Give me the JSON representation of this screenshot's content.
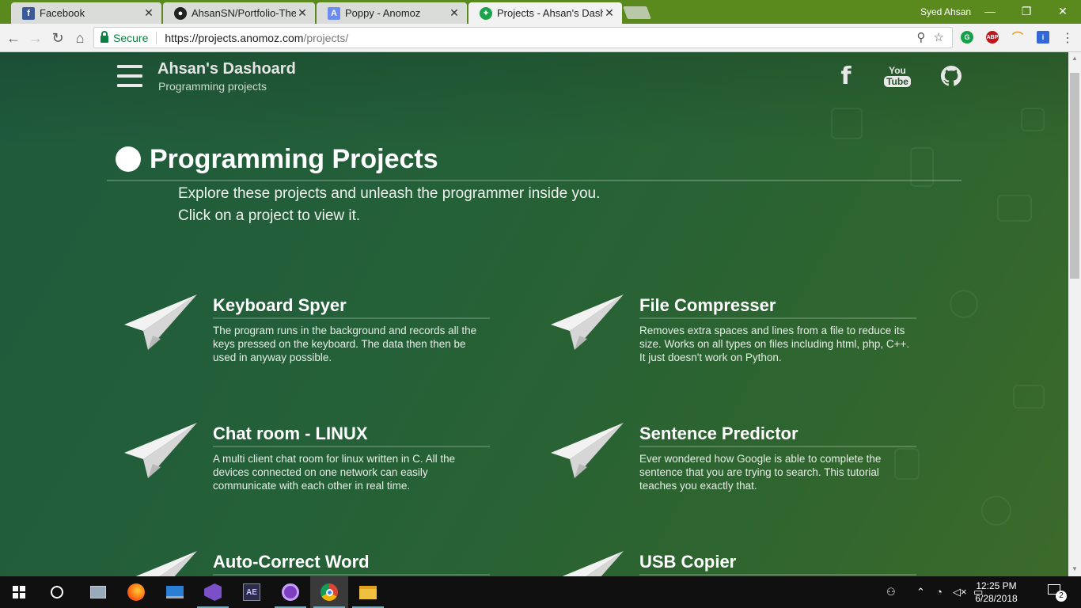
{
  "browser": {
    "tabs": [
      {
        "title": "Facebook",
        "favicon": "facebook-icon",
        "color": "#3b5998",
        "active": false
      },
      {
        "title": "AhsanSN/Portfolio-Them",
        "favicon": "github-icon",
        "color": "#222222",
        "active": false
      },
      {
        "title": "Poppy - Anomoz",
        "favicon": "poppy-icon",
        "color": "#6c8cf0",
        "active": false
      },
      {
        "title": "Projects - Ahsan's Dashb",
        "favicon": "projects-icon",
        "color": "#1aa34a",
        "active": true
      }
    ],
    "profile_name": "Syed Ahsan",
    "secure_label": "Secure",
    "url_host": "https://projects.anomoz.com",
    "url_path": "/projects/"
  },
  "site": {
    "title": "Ahsan's Dashoard",
    "subtitle": "Programming projects",
    "social": [
      {
        "name": "facebook-icon",
        "glyph": "f"
      },
      {
        "name": "youtube-icon",
        "you": "You",
        "tube": "Tube"
      },
      {
        "name": "github-icon"
      }
    ]
  },
  "main": {
    "heading": "Programming Projects",
    "intro_line1": "Explore these projects and unleash the programmer inside you.",
    "intro_line2": "Click on a project to view it.",
    "projects": [
      {
        "title": "Keyboard Spyer",
        "description": "The program runs in the background and records all the keys pressed on the keyboard. The data then then be used in anyway possible."
      },
      {
        "title": "File Compresser",
        "description": "Removes extra spaces and lines from a file to reduce its size. Works on all types on files including html, php, C++. It just doesn't work on Python."
      },
      {
        "title": "Chat room - LINUX",
        "description": "A multi client chat room for linux written in C. All the devices connected on one network can easily communicate with each other in real time."
      },
      {
        "title": "Sentence Predictor",
        "description": "Ever wondered how Google is able to complete the sentence that you are trying to search. This tutorial teaches you exactly that."
      },
      {
        "title": "Auto-Correct Word",
        "description": ""
      },
      {
        "title": "USB Copier",
        "description": ""
      }
    ]
  },
  "taskbar": {
    "time": "12:25 PM",
    "date": "6/28/2018",
    "notifications": "2"
  }
}
